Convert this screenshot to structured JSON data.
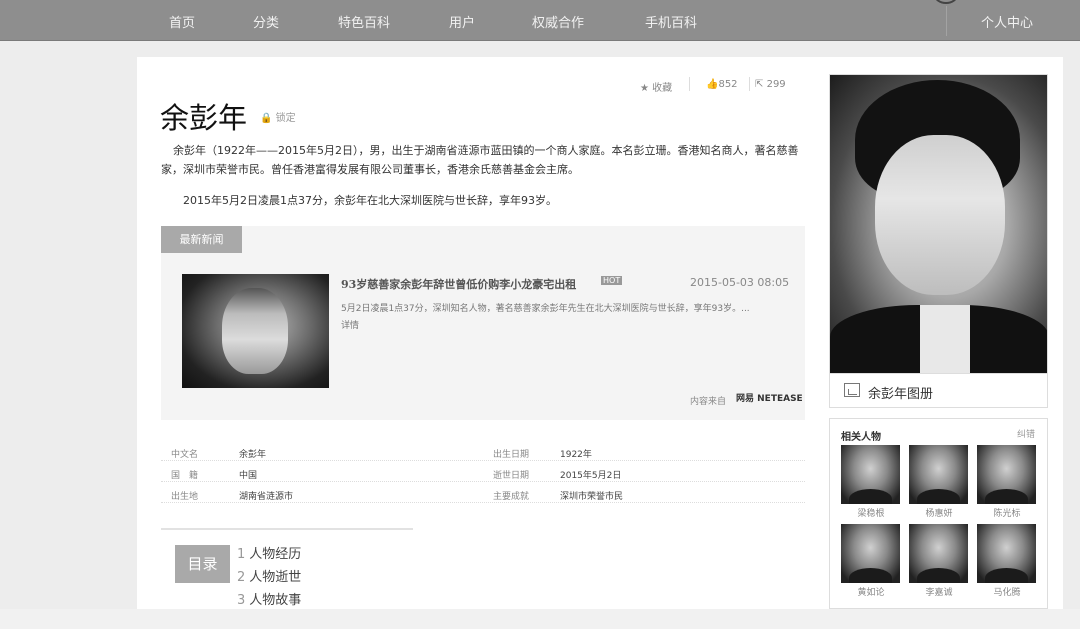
{
  "nav": {
    "items": [
      "首页",
      "分类",
      "特色百科",
      "用户",
      "权威合作",
      "手机百科"
    ],
    "user_center": "个人中心"
  },
  "entry": {
    "title": "余彭年",
    "lock_label": "锁定",
    "favorite": "收藏",
    "likes": "852",
    "shares": "299",
    "summary": "余彭年（1922年——2015年5月2日），男，出生于湖南省涟源市蓝田镇的一个商人家庭。本名彭立珊。香港知名商人，著名慈善家，深圳市荣誉市民。曾任香港富得发展有限公司董事长，香港余氏慈善基金会主席。",
    "death_note": "2015年5月2日凌晨1点37分，余彭年在北大深圳医院与世长辞，享年93岁。"
  },
  "news": {
    "tab": "最新新闻",
    "title": "93岁慈善家余彭年辞世曾低价购李小龙豪宅出租",
    "hot_badge": "HOT",
    "date": "2015-05-03 08:05",
    "text": "5月2日凌晨1点37分，深圳知名人物，著名慈善家余彭年先生在北大深圳医院与世长辞，享年93岁。...",
    "detail_link": "详情",
    "source_label": "内容来自",
    "source_name": "网易 NETEASE"
  },
  "info": {
    "rows": [
      {
        "k1": "中文名",
        "v1": "余彭年",
        "k2": "出生日期",
        "v2": "1922年"
      },
      {
        "k1": "国　籍",
        "v1": "中国",
        "k2": "逝世日期",
        "v2": "2015年5月2日"
      },
      {
        "k1": "出生地",
        "v1": "湖南省涟源市",
        "k2": "主要成就",
        "v2": "深圳市荣誉市民"
      }
    ]
  },
  "toc": {
    "label": "目录",
    "items": [
      {
        "num": "1",
        "text": "人物经历"
      },
      {
        "num": "2",
        "text": "人物逝世"
      },
      {
        "num": "3",
        "text": "人物故事"
      }
    ]
  },
  "sidebar": {
    "album_label": "余彭年图册",
    "related_heading": "相关人物",
    "correction": "纠错",
    "people": [
      "梁稳根",
      "杨惠妍",
      "陈光标",
      "黄如论",
      "李嘉诚",
      "马化腾"
    ]
  }
}
